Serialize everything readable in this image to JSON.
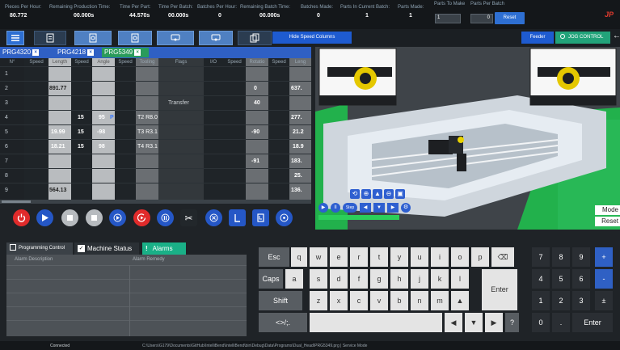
{
  "stats": {
    "pieces_per_hour_label": "Pieces Per Hour:",
    "pieces_per_hour": "80.772",
    "remaining_production_label": "Remaining Production Time:",
    "remaining_production": "00.000s",
    "time_per_part_label": "Time Per Part:",
    "time_per_part": "44.570s",
    "time_per_batch_label": "Time Per Batch:",
    "time_per_batch": "00.000s",
    "batches_per_hour_label": "Batches Per Hour:",
    "batches_per_hour": "0",
    "remaining_batch_label": "Remaining Batch Time:",
    "remaining_batch": "00.000s",
    "batches_made_label": "Batches Made:",
    "batches_made": "0",
    "parts_current_batch_label": "Parts In Current Batch:",
    "parts_current_batch": "1",
    "parts_made_label": "Parts Made:",
    "parts_made": "1",
    "parts_to_make_label": "Parts To Make",
    "parts_to_make": "1",
    "parts_per_batch_label": "Parts Per Batch",
    "parts_per_batch": "0",
    "reset_label": "Reset",
    "logo_text": "JP"
  },
  "toolbar": {
    "hide_speed_label": "Hide Speed Columns",
    "feeder_label": "Feeder",
    "jog_label": "JOG CONTROL"
  },
  "program_tabs": [
    {
      "label": "PRG4320",
      "close": "×"
    },
    {
      "label": "PRG4218",
      "close": "×"
    },
    {
      "label": "PRG5349",
      "close": "×"
    }
  ],
  "table": {
    "headers": [
      "N°",
      "Speed",
      "Length",
      "Speed",
      "Angle",
      "Speed",
      "Tooling",
      "Flags",
      "I/O",
      "Speed",
      "Rotatio",
      "Speed",
      "Leng"
    ],
    "rows": [
      {
        "n": "1",
        "length": "",
        "speed2": "",
        "angle": "",
        "tooling": "",
        "flags": "",
        "rotation": "",
        "leng": ""
      },
      {
        "n": "2",
        "length": "891.77",
        "speed2": "",
        "angle": "",
        "tooling": "",
        "flags": "",
        "rotation": "0",
        "leng": "637."
      },
      {
        "n": "3",
        "length": "",
        "speed2": "",
        "angle": "",
        "tooling": "",
        "flags": "Transfer",
        "rotation": "40",
        "leng": ""
      },
      {
        "n": "4",
        "length": "",
        "speed2": "15",
        "angle": "95",
        "tooling": "T2 R8.0",
        "flags": "",
        "rotation": "",
        "leng": "277."
      },
      {
        "n": "5",
        "length": "19.99",
        "speed2": "15",
        "angle": "-98",
        "tooling": "T3 R3.1",
        "flags": "",
        "rotation": "-90",
        "leng": "21.2"
      },
      {
        "n": "6",
        "length": "18.21",
        "speed2": "15",
        "angle": "98",
        "tooling": "T4 R3.1",
        "flags": "",
        "rotation": "",
        "leng": "18.9"
      },
      {
        "n": "7",
        "length": "",
        "speed2": "",
        "angle": "",
        "tooling": "",
        "flags": "",
        "rotation": "-91",
        "leng": "183."
      },
      {
        "n": "8",
        "length": "",
        "speed2": "",
        "angle": "",
        "tooling": "",
        "flags": "",
        "rotation": "",
        "leng": "25."
      },
      {
        "n": "9",
        "length": "564.13",
        "speed2": "",
        "angle": "",
        "tooling": "",
        "flags": "",
        "rotation": "",
        "leng": "136."
      }
    ],
    "angle_marker": "P"
  },
  "view3d": {
    "step_label": "Step",
    "mode_label": "Mode",
    "reset_label": "Reset"
  },
  "bottom_tabs": {
    "programming": "Programming Control",
    "machine_status": "Machine Status",
    "alarms": "Alarms",
    "alarm_mark": "!"
  },
  "alarms": {
    "col_description": "Alarm Description",
    "col_remedy": "Alarm Remedy"
  },
  "keyboard": {
    "row1": [
      "Esc",
      "q",
      "w",
      "e",
      "r",
      "t",
      "y",
      "u",
      "i",
      "o",
      "p",
      "⌫"
    ],
    "row2": [
      "Caps",
      "a",
      "s",
      "d",
      "f",
      "g",
      "h",
      "j",
      "k",
      "l"
    ],
    "row3": [
      "Shift",
      "z",
      "x",
      "c",
      "v",
      "b",
      "n",
      "m",
      "▲"
    ],
    "row4": [
      "<>/;.",
      "◀",
      "▼",
      "▶",
      "?"
    ],
    "enter": "Enter"
  },
  "numpad": {
    "keys": [
      "7",
      "8",
      "9",
      "+",
      "4",
      "5",
      "6",
      "-",
      "1",
      "2",
      "3",
      "±",
      "0",
      ".",
      "Enter"
    ]
  },
  "statusbar": {
    "connection": "Connected",
    "path": "C:\\Users\\G179\\Documents\\GitHub\\IntelliBend\\IntelliBend\\bin\\Debug\\Data\\Programs\\Dual_Head\\PRG5349.prg | Service Mode"
  }
}
